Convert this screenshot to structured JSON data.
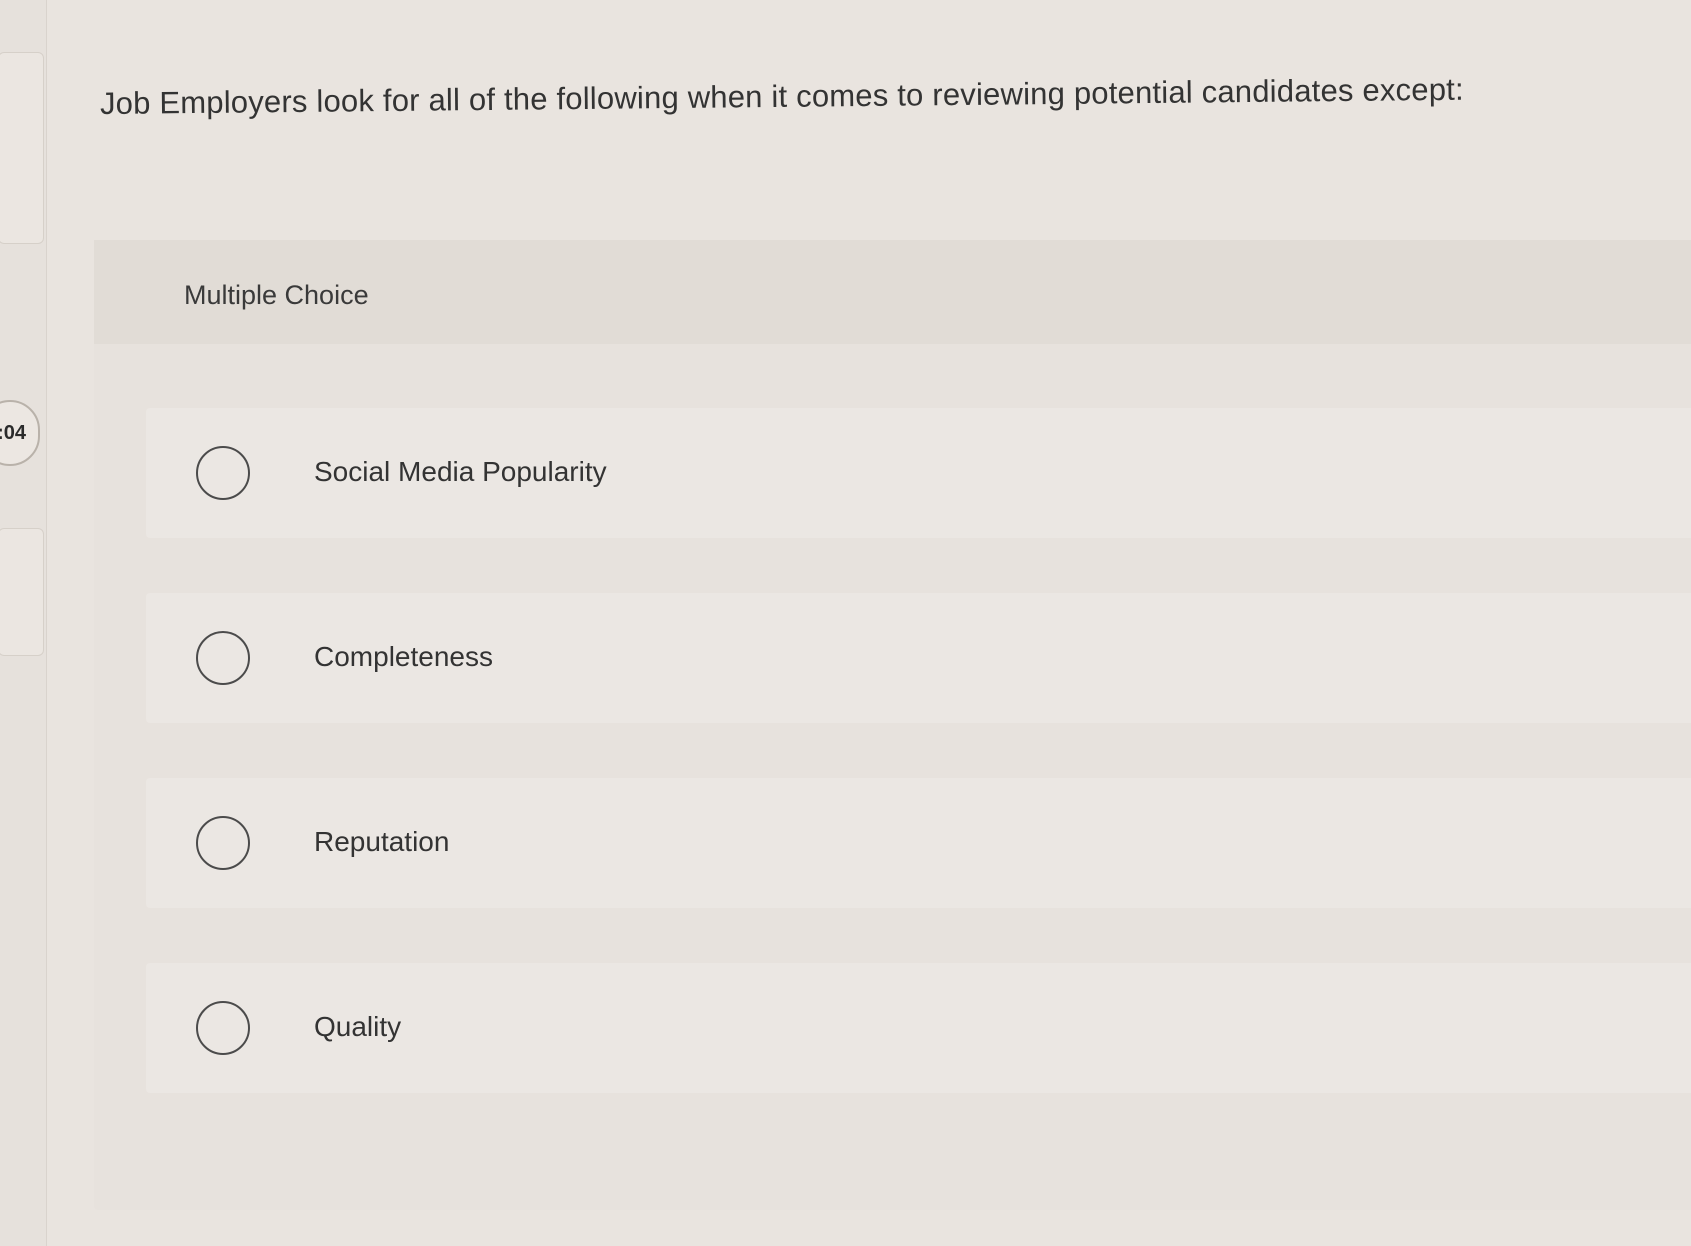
{
  "sidebar": {
    "question_number": ":04"
  },
  "question": {
    "text": "Job Employers look for all of the following when it comes to reviewing potential candidates except:"
  },
  "card": {
    "type_label": "Multiple Choice",
    "choices": [
      {
        "label": "Social Media Popularity",
        "selected": false
      },
      {
        "label": "Completeness",
        "selected": false
      },
      {
        "label": "Reputation",
        "selected": false
      },
      {
        "label": "Quality",
        "selected": false
      }
    ]
  }
}
